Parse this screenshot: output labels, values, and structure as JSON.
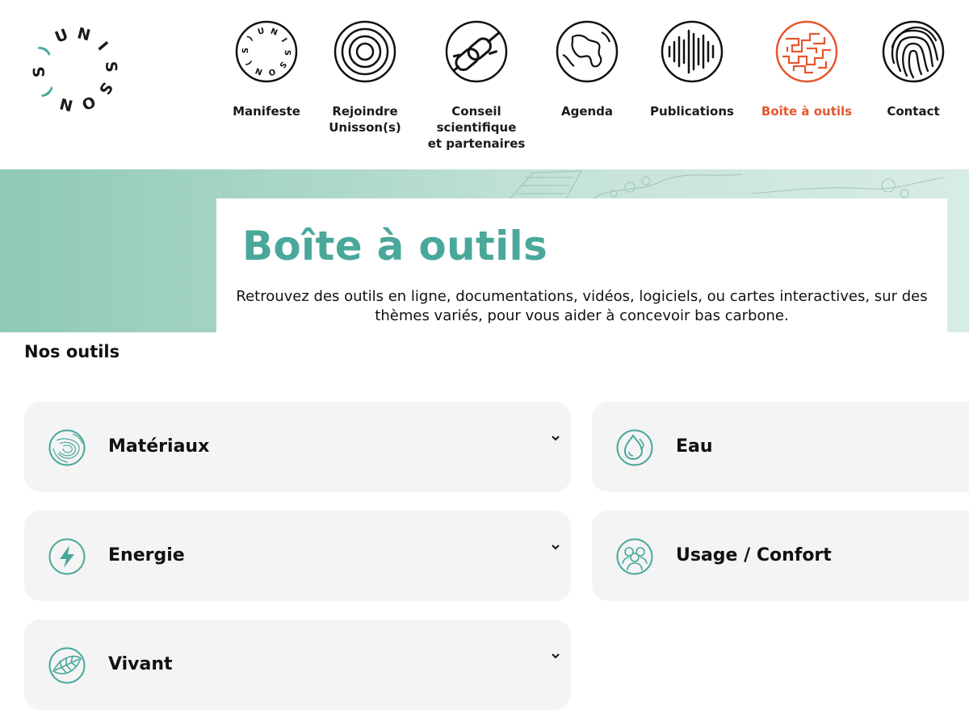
{
  "logo": {
    "letters": [
      "U",
      "N",
      "I",
      "S",
      "S",
      "O",
      "N",
      "(",
      "S",
      ")"
    ],
    "accent_color": "#4aa89b"
  },
  "nav": {
    "items": [
      {
        "label": "Manifeste",
        "icon": "unisson-circle-icon",
        "active": false
      },
      {
        "label": "Rejoindre\nUnisson(s)",
        "icon": "concentric-circles-icon",
        "active": false
      },
      {
        "label": "Conseil\nscientifique\net partenaires",
        "icon": "chain-link-icon",
        "active": false
      },
      {
        "label": "Agenda",
        "icon": "globe-icon",
        "active": false
      },
      {
        "label": "Publications",
        "icon": "sound-wave-icon",
        "active": false
      },
      {
        "label": "Boîte à outils",
        "icon": "maze-icon",
        "active": true
      },
      {
        "label": "Contact",
        "icon": "fingerprint-icon",
        "active": false
      }
    ],
    "active_color": "#e4572e"
  },
  "hero": {
    "title": "Boîte à outils",
    "description": "Retrouvez des outils en ligne, documentations, vidéos, logiciels, ou cartes interactives, sur des thèmes variés, pour vous aider à concevoir bas carbone."
  },
  "tools": {
    "section_title": "Nos outils",
    "items": [
      {
        "label": "Matériaux",
        "icon": "wood-grain-icon"
      },
      {
        "label": "Eau",
        "icon": "water-drop-icon"
      },
      {
        "label": "Energie",
        "icon": "lightning-icon"
      },
      {
        "label": "Usage / Confort",
        "icon": "people-icon"
      },
      {
        "label": "Vivant",
        "icon": "leaf-icon"
      }
    ]
  },
  "colors": {
    "accent": "#4aa89b",
    "card_background": "#f4f4f4"
  }
}
